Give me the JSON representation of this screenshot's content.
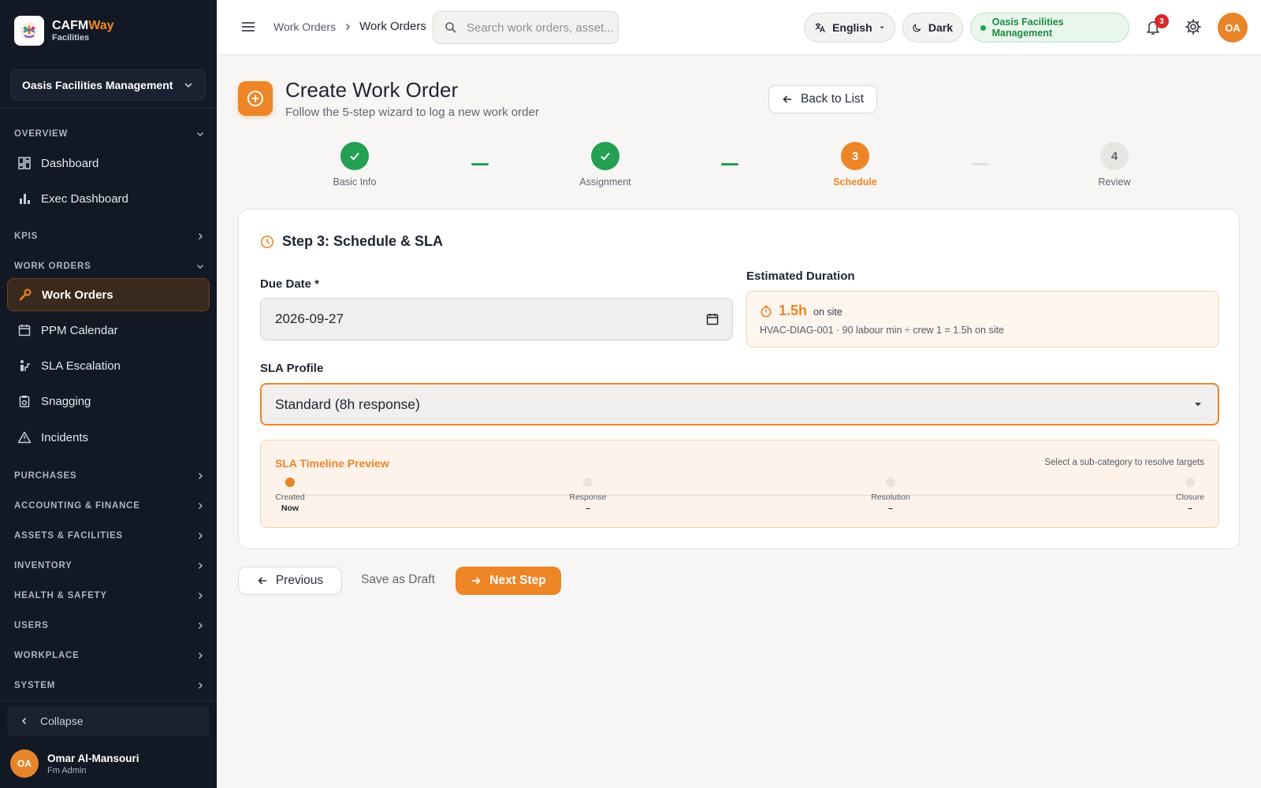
{
  "brand": {
    "name_part1": "CAFM",
    "name_part2": "Way",
    "subtitle": "Facilities"
  },
  "sidebar": {
    "org_selector": "Oasis Facilities Management",
    "sections": {
      "overview": "OVERVIEW",
      "kpis": "KPIS",
      "work_orders": "WORK ORDERS",
      "purchases": "PURCHASES",
      "accounting": "ACCOUNTING & FINANCE",
      "assets": "ASSETS & FACILITIES",
      "inventory": "INVENTORY",
      "health": "HEALTH & SAFETY",
      "users": "USERS",
      "workplace": "WORKPLACE",
      "system": "SYSTEM"
    },
    "items": {
      "dashboard": "Dashboard",
      "exec_dashboard": "Exec Dashboard",
      "work_orders": "Work Orders",
      "ppm_calendar": "PPM Calendar",
      "sla_escalation": "SLA Escalation",
      "snagging": "Snagging",
      "incidents": "Incidents"
    },
    "collapse": "Collapse",
    "user": {
      "initials": "OA",
      "name": "Omar Al-Mansouri",
      "role": "Fm Admin"
    }
  },
  "topbar": {
    "breadcrumb": [
      "Work Orders",
      "Work Orders"
    ],
    "search_placeholder": "Search work orders, asset...",
    "language": "English",
    "theme": "Dark",
    "org": "Oasis Facilities Management",
    "notification_count": "3",
    "avatar_initials": "OA"
  },
  "page": {
    "title": "Create Work Order",
    "subtitle": "Follow the 5-step wizard to log a new work order",
    "back_button": "Back to List"
  },
  "stepper": {
    "steps": [
      {
        "label": "Basic Info",
        "state": "done",
        "number": ""
      },
      {
        "label": "Assignment",
        "state": "done",
        "number": ""
      },
      {
        "label": "Schedule",
        "state": "current",
        "number": "3"
      },
      {
        "label": "Review",
        "state": "todo",
        "number": "4"
      }
    ]
  },
  "form": {
    "card_title": "Step 3: Schedule & SLA",
    "due_date_label": "Due Date *",
    "due_date_value": "2026-09-27",
    "duration_label": "Estimated Duration",
    "duration_value": "1.5h",
    "duration_unit": "on site",
    "duration_detail": "HVAC-DIAG-001 · 90 labour min ÷ crew 1 = 1.5h on site",
    "sla_label": "SLA Profile",
    "sla_value": "Standard (8h response)"
  },
  "timeline": {
    "title": "SLA Timeline Preview",
    "hint": "Select a sub-category to resolve targets",
    "points": [
      {
        "label": "Created",
        "value": "Now"
      },
      {
        "label": "Response",
        "value": "–"
      },
      {
        "label": "Resolution",
        "value": "–"
      },
      {
        "label": "Closure",
        "value": "–"
      }
    ]
  },
  "footer": {
    "previous": "Previous",
    "save_draft": "Save as Draft",
    "next": "Next Step"
  },
  "colors": {
    "accent": "#ee8526",
    "success": "#23a052",
    "sidebar_bg": "#121824"
  }
}
